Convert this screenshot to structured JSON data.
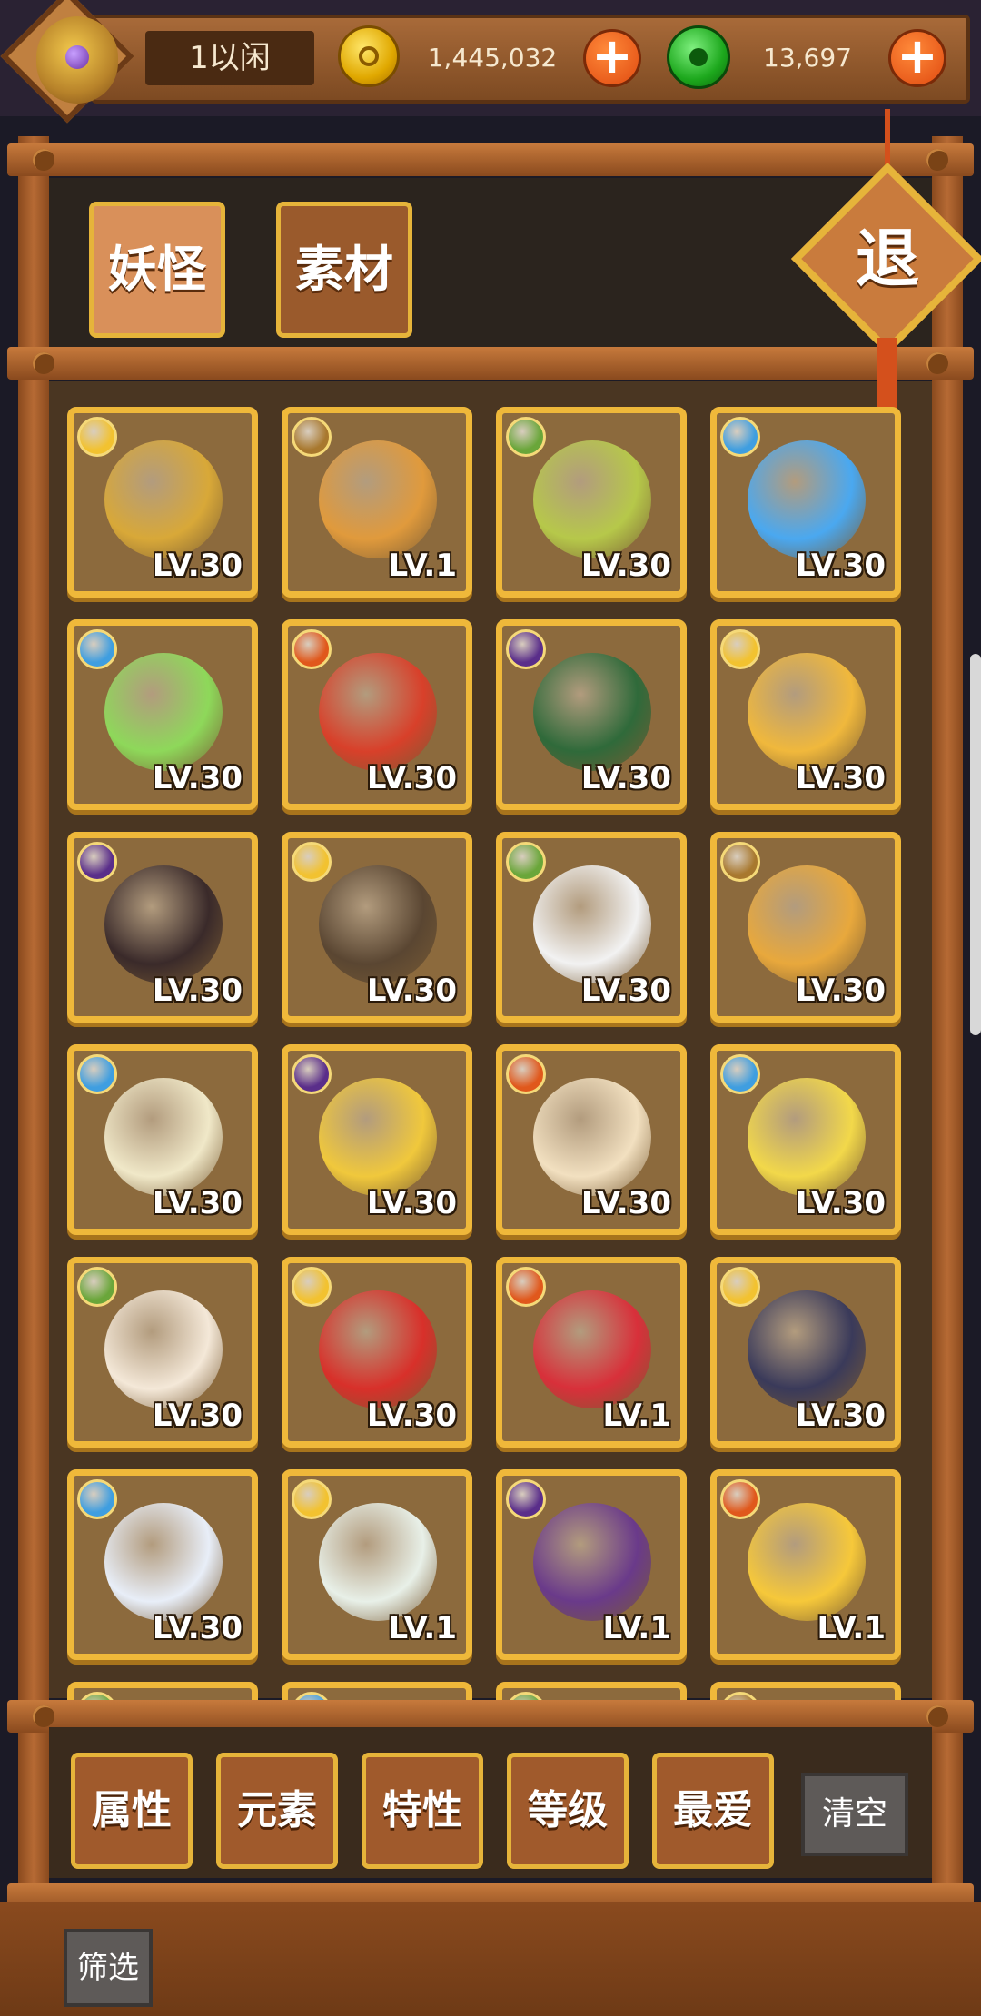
{
  "top_bar": {
    "username": "1以闲",
    "gold": "1,445,032",
    "jade": "13,697",
    "gold_icon": "coin-icon",
    "jade_icon": "jade-icon",
    "add_glyph": "+"
  },
  "tabs": [
    {
      "label": "妖怪",
      "active": true
    },
    {
      "label": "素材",
      "active": false
    }
  ],
  "exit_label": "退",
  "element_colors": {
    "sun": "#f2c230",
    "earth": "#a8782e",
    "wood": "#6aa63a",
    "water": "#3f9ee0",
    "moon": "#5a2e8a",
    "fire": "#e0581c"
  },
  "monsters": [
    {
      "element": "sun",
      "level": "LV.30",
      "color": "#d8a838"
    },
    {
      "element": "earth",
      "level": "LV.1",
      "color": "#e09a3c"
    },
    {
      "element": "wood",
      "level": "LV.30",
      "color": "#b6c84a"
    },
    {
      "element": "water",
      "level": "LV.30",
      "color": "#4aa8f0"
    },
    {
      "element": "water",
      "level": "LV.30",
      "color": "#8ed85a"
    },
    {
      "element": "fire",
      "level": "LV.30",
      "color": "#d8402a"
    },
    {
      "element": "moon",
      "level": "LV.30",
      "color": "#2f6a3a"
    },
    {
      "element": "sun",
      "level": "LV.30",
      "color": "#f0b83c"
    },
    {
      "element": "moon",
      "level": "LV.30",
      "color": "#3a2a2a"
    },
    {
      "element": "sun",
      "level": "LV.30",
      "color": "#5a4632"
    },
    {
      "element": "wood",
      "level": "LV.30",
      "color": "#f2f2f2"
    },
    {
      "element": "earth",
      "level": "LV.30",
      "color": "#e8a83c"
    },
    {
      "element": "water",
      "level": "LV.30",
      "color": "#f0e8c8"
    },
    {
      "element": "moon",
      "level": "LV.30",
      "color": "#f0c83c"
    },
    {
      "element": "fire",
      "level": "LV.30",
      "color": "#f2e0c0"
    },
    {
      "element": "water",
      "level": "LV.30",
      "color": "#f2d84a"
    },
    {
      "element": "wood",
      "level": "LV.30",
      "color": "#f4e8d8"
    },
    {
      "element": "sun",
      "level": "LV.30",
      "color": "#d8302a"
    },
    {
      "element": "fire",
      "level": "LV.1",
      "color": "#d8303a"
    },
    {
      "element": "sun",
      "level": "LV.30",
      "color": "#3a3a5a"
    },
    {
      "element": "water",
      "level": "LV.30",
      "color": "#e8eef8"
    },
    {
      "element": "sun",
      "level": "LV.1",
      "color": "#e8f0e8"
    },
    {
      "element": "moon",
      "level": "LV.1",
      "color": "#6a3a8a"
    },
    {
      "element": "fire",
      "level": "LV.1",
      "color": "#f6c83a"
    },
    {
      "element": "wood",
      "level": "",
      "color": "#8c6a3d"
    },
    {
      "element": "water",
      "level": "",
      "color": "#8c6a3d"
    },
    {
      "element": "wood",
      "level": "",
      "color": "#8c6a3d"
    },
    {
      "element": "earth",
      "level": "",
      "color": "#8c6a3d"
    }
  ],
  "filters": [
    {
      "label": "属性"
    },
    {
      "label": "元素"
    },
    {
      "label": "特性"
    },
    {
      "label": "等级"
    },
    {
      "label": "最爱"
    }
  ],
  "clear_label": "清空",
  "filter_toggle_label": "筛选"
}
